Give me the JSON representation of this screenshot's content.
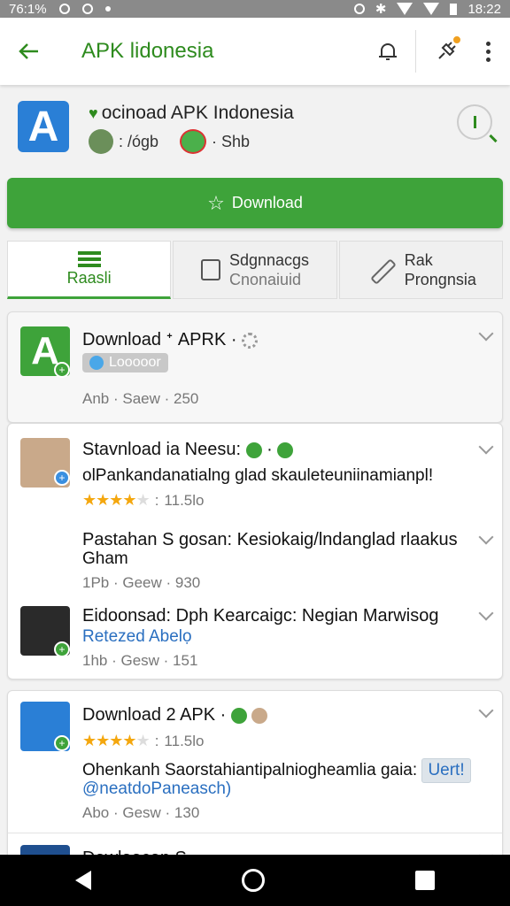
{
  "status_bar": {
    "left_text": "76:1%",
    "time": "18:22"
  },
  "appbar": {
    "title": "APK lidonesia"
  },
  "app": {
    "logo_letter": "A",
    "name": "ocinoad APK Indonesia",
    "meta_1": ": /ógb",
    "meta_2": "· Shb"
  },
  "download_button": {
    "label": "Download"
  },
  "tabs": [
    {
      "label": "Raasli"
    },
    {
      "label": "Sdgnnacgs",
      "sub": "Cnonaiuid"
    },
    {
      "label": "Rak",
      "sub": "Prongnsia"
    }
  ],
  "card1": {
    "title": "Download ᐩ APRK ·",
    "chip": "Looooor",
    "meta": "Anb · Saew · 250"
  },
  "card2": {
    "items": [
      {
        "title": "Stavnload ia Neesu:",
        "line2": "olPankandanatialng glad skauleteuniinamianpl!",
        "rating": "11.5lo",
        "meta": ""
      },
      {
        "title": "Pastahan S gosan: Kesiokaig/lndanglad rlaakus",
        "line2": "Gham",
        "meta": "1Pb · Geew · 930"
      },
      {
        "title": "Eidoonsad: Dph Kearcaigc: Negian Marwisog",
        "line2": "Retezed Abelọ",
        "meta": "1hb · Gesw · 151"
      }
    ]
  },
  "card3": {
    "title": "Download 2 APK ·",
    "rating": "11.5lo",
    "line2": "Ohenkanh Saorstahiantipalniogheamlia gaia:",
    "tag": "Uert!",
    "line3": "@neatdoPaneasch)",
    "meta": "Abo · Gesw · 130",
    "next_title": "Dawlaacan S"
  },
  "colors": {
    "accent": "#3ea33a",
    "title_green": "#2e8b1e",
    "link_blue": "#2a6fc0",
    "star": "#f4a70e"
  }
}
